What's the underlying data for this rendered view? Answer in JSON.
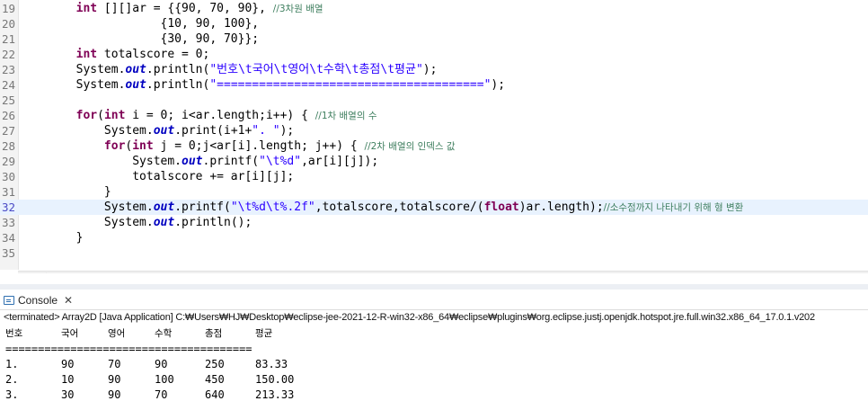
{
  "editor": {
    "lines": [
      {
        "num": "19",
        "current": false,
        "tokens": [
          {
            "t": "        ",
            "c": ""
          },
          {
            "t": "int",
            "c": "kw"
          },
          {
            "t": " [][]ar = {{90, 70, 90}, ",
            "c": ""
          },
          {
            "t": "//3차원 배열",
            "c": "cm"
          }
        ]
      },
      {
        "num": "20",
        "current": false,
        "tokens": [
          {
            "t": "                    {10, 90, 100},",
            "c": ""
          }
        ]
      },
      {
        "num": "21",
        "current": false,
        "tokens": [
          {
            "t": "                    {30, 90, 70}};",
            "c": ""
          }
        ]
      },
      {
        "num": "22",
        "current": false,
        "tokens": [
          {
            "t": "        ",
            "c": ""
          },
          {
            "t": "int",
            "c": "kw"
          },
          {
            "t": " totalscore = 0;",
            "c": ""
          }
        ]
      },
      {
        "num": "23",
        "current": false,
        "tokens": [
          {
            "t": "        System.",
            "c": ""
          },
          {
            "t": "out",
            "c": "fld"
          },
          {
            "t": ".println(",
            "c": ""
          },
          {
            "t": "\"번호\\t국어\\t영어\\t수학\\t총점\\t평균\"",
            "c": "str"
          },
          {
            "t": ");",
            "c": ""
          }
        ]
      },
      {
        "num": "24",
        "current": false,
        "tokens": [
          {
            "t": "        System.",
            "c": ""
          },
          {
            "t": "out",
            "c": "fld"
          },
          {
            "t": ".println(",
            "c": ""
          },
          {
            "t": "\"======================================\"",
            "c": "str"
          },
          {
            "t": ");",
            "c": ""
          }
        ]
      },
      {
        "num": "25",
        "current": false,
        "tokens": []
      },
      {
        "num": "26",
        "current": false,
        "tokens": [
          {
            "t": "        ",
            "c": ""
          },
          {
            "t": "for",
            "c": "kw"
          },
          {
            "t": "(",
            "c": ""
          },
          {
            "t": "int",
            "c": "kw"
          },
          {
            "t": " i = 0; i<ar.length;i++) { ",
            "c": ""
          },
          {
            "t": "//1차 배열의 수",
            "c": "cm"
          }
        ]
      },
      {
        "num": "27",
        "current": false,
        "tokens": [
          {
            "t": "            System.",
            "c": ""
          },
          {
            "t": "out",
            "c": "fld"
          },
          {
            "t": ".print(i+1+",
            "c": ""
          },
          {
            "t": "\". \"",
            "c": "str"
          },
          {
            "t": ");",
            "c": ""
          }
        ]
      },
      {
        "num": "28",
        "current": false,
        "tokens": [
          {
            "t": "            ",
            "c": ""
          },
          {
            "t": "for",
            "c": "kw"
          },
          {
            "t": "(",
            "c": ""
          },
          {
            "t": "int",
            "c": "kw"
          },
          {
            "t": " j = 0;j<ar[i].length; j++) { ",
            "c": ""
          },
          {
            "t": "//2차 배열의 인덱스 값",
            "c": "cm"
          }
        ]
      },
      {
        "num": "29",
        "current": false,
        "tokens": [
          {
            "t": "                System.",
            "c": ""
          },
          {
            "t": "out",
            "c": "fld"
          },
          {
            "t": ".printf(",
            "c": ""
          },
          {
            "t": "\"\\t%d\"",
            "c": "str"
          },
          {
            "t": ",ar[i][j]);",
            "c": ""
          }
        ]
      },
      {
        "num": "30",
        "current": false,
        "tokens": [
          {
            "t": "                totalscore += ar[i][j];",
            "c": ""
          }
        ]
      },
      {
        "num": "31",
        "current": false,
        "tokens": [
          {
            "t": "            }",
            "c": ""
          }
        ]
      },
      {
        "num": "32",
        "current": true,
        "tokens": [
          {
            "t": "            System.",
            "c": ""
          },
          {
            "t": "out",
            "c": "fld"
          },
          {
            "t": ".printf(",
            "c": ""
          },
          {
            "t": "\"\\t%d\\t%.2f\"",
            "c": "str"
          },
          {
            "t": ",totalscore,totalscore/(",
            "c": ""
          },
          {
            "t": "float",
            "c": "kw"
          },
          {
            "t": ")ar.length);",
            "c": ""
          },
          {
            "t": "//소수점까지 나타내기 위해 형 변환",
            "c": "cm"
          }
        ]
      },
      {
        "num": "33",
        "current": false,
        "tokens": [
          {
            "t": "            System.",
            "c": ""
          },
          {
            "t": "out",
            "c": "fld"
          },
          {
            "t": ".println();",
            "c": ""
          }
        ]
      },
      {
        "num": "34",
        "current": false,
        "tokens": [
          {
            "t": "        }",
            "c": ""
          }
        ]
      },
      {
        "num": "35",
        "current": false,
        "tokens": []
      }
    ],
    "scroll_arrow": "<"
  },
  "console": {
    "tab_label": "Console",
    "close_symbol": "✕",
    "terminated_text": "<terminated> Array2D [Java Application] C:₩Users₩HJ₩Desktop₩eclipse-jee-2021-12-R-win32-x86_64₩eclipse₩plugins₩org.eclipse.justj.openjdk.hotspot.jre.full.win32.x86_64_17.0.1.v202",
    "headers": [
      "번호",
      "국어",
      "영어",
      "수학",
      "총점",
      "평균"
    ],
    "separator": "======================================",
    "rows": [
      [
        "1.",
        "90",
        "70",
        "90",
        "250",
        "83.33"
      ],
      [
        "2.",
        "10",
        "90",
        "100",
        "450",
        "150.00"
      ],
      [
        "3.",
        "30",
        "90",
        "70",
        "640",
        "213.33"
      ]
    ]
  }
}
